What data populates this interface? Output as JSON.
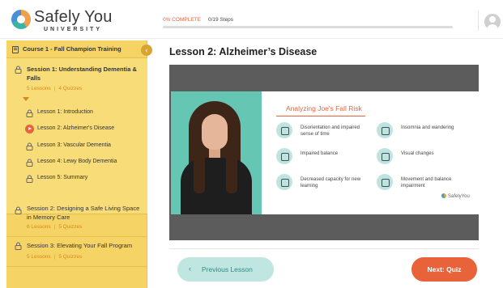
{
  "brand": {
    "name": "Safely You",
    "sub": "UNIVERSITY"
  },
  "progress": {
    "percent_label": "0% COMPLETE",
    "steps_label": "0/19 Steps",
    "fraction": 0.0
  },
  "sidebar": {
    "course_title": "Course 1 - Fall Champion Training",
    "sessions": [
      {
        "title": "Session 1: Understanding Dementia & Falls",
        "lessons_count": "5 Lessons",
        "quizzes_count": "4 Quizzes",
        "lessons": [
          {
            "label": "Lesson 1: Introduction",
            "active": false
          },
          {
            "label": "Lesson 2: Alzheimer's Disease",
            "active": true
          },
          {
            "label": "Lesson 3: Vascular Dementia",
            "active": false
          },
          {
            "label": "Lesson 4: Lewy Body Dementia",
            "active": false
          },
          {
            "label": "Lesson 5: Summary",
            "active": false
          }
        ]
      },
      {
        "title": "Session 2: Designing a Safe Living Space in Memory Care",
        "lessons_count": "6 Lessons",
        "quizzes_count": "5 Quizzes"
      },
      {
        "title": "Session 3: Elevating Your Fall Program",
        "lessons_count": "5 Lessons",
        "quizzes_count": "5 Quizzes"
      }
    ]
  },
  "main": {
    "lesson_title": "Lesson 2: Alzheimer’s Disease",
    "slide": {
      "title": "Analyzing Joe's Fall Risk",
      "risks": [
        "Disorientation and impaired sense of time",
        "Insomnia and wandering",
        "Impaired balance",
        "Visual changes",
        "Decreased capacity for new learning",
        "Movement and balance impairment"
      ],
      "logo_text": "SafelyYou"
    },
    "prev_label": "Previous Lesson",
    "prev_chevron": "‹",
    "next_label": "Next: Quiz"
  },
  "colors": {
    "accent": "#e8623a",
    "sidebar": "#f6d365",
    "teal": "#66c6b4"
  }
}
